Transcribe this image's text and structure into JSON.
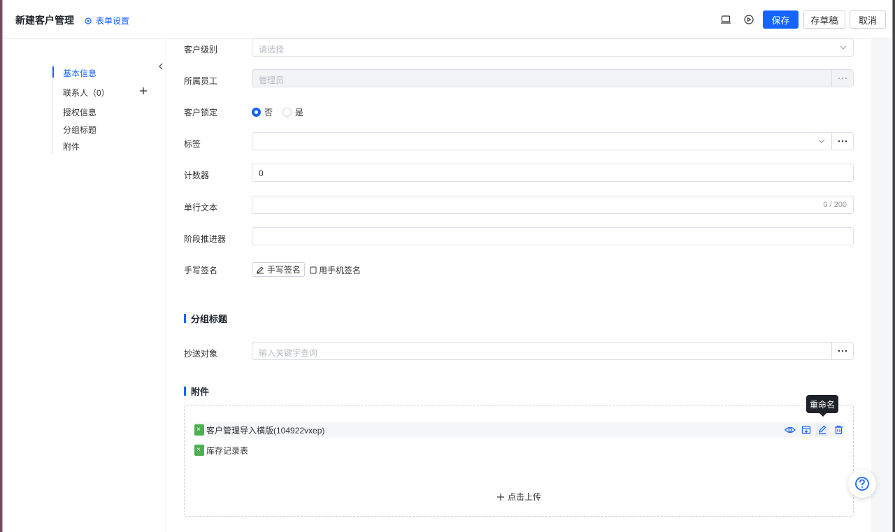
{
  "header": {
    "title": "新建客户管理",
    "settings_label": "表单设置",
    "save_label": "保存",
    "draft_label": "存草稿",
    "cancel_label": "取消"
  },
  "nav": {
    "items": [
      {
        "label": "基本信息",
        "active": true
      },
      {
        "label": "联系人（0）"
      },
      {
        "label": "授权信息"
      },
      {
        "label": "分组标题"
      },
      {
        "label": "附件"
      }
    ]
  },
  "form": {
    "level": {
      "label": "客户级别",
      "placeholder": "请选择"
    },
    "employee": {
      "label": "所属员工",
      "value": "管理员"
    },
    "lock": {
      "label": "客户锁定",
      "options": [
        "否",
        "是"
      ],
      "selected": "否"
    },
    "tags": {
      "label": "标签",
      "value": ""
    },
    "counter": {
      "label": "计数器",
      "value": "0"
    },
    "single_text": {
      "label": "单行文本",
      "count": "0 / 200"
    },
    "stage": {
      "label": "阶段推进器"
    },
    "signature": {
      "label": "手写签名",
      "button": "手写签名",
      "phone": "用手机签名"
    }
  },
  "group": {
    "title": "分组标题",
    "cc": {
      "label": "抄送对象",
      "placeholder": "输入关键字查询"
    }
  },
  "attachments": {
    "title": "附件",
    "files": [
      {
        "name": "客户管理导入横版(104922vxep)"
      },
      {
        "name": "库存记录表"
      }
    ],
    "upload_label": "点击上传",
    "tooltip": "重命名"
  },
  "colors": {
    "primary": "#1664ff",
    "file_icon": "#4caf50"
  }
}
